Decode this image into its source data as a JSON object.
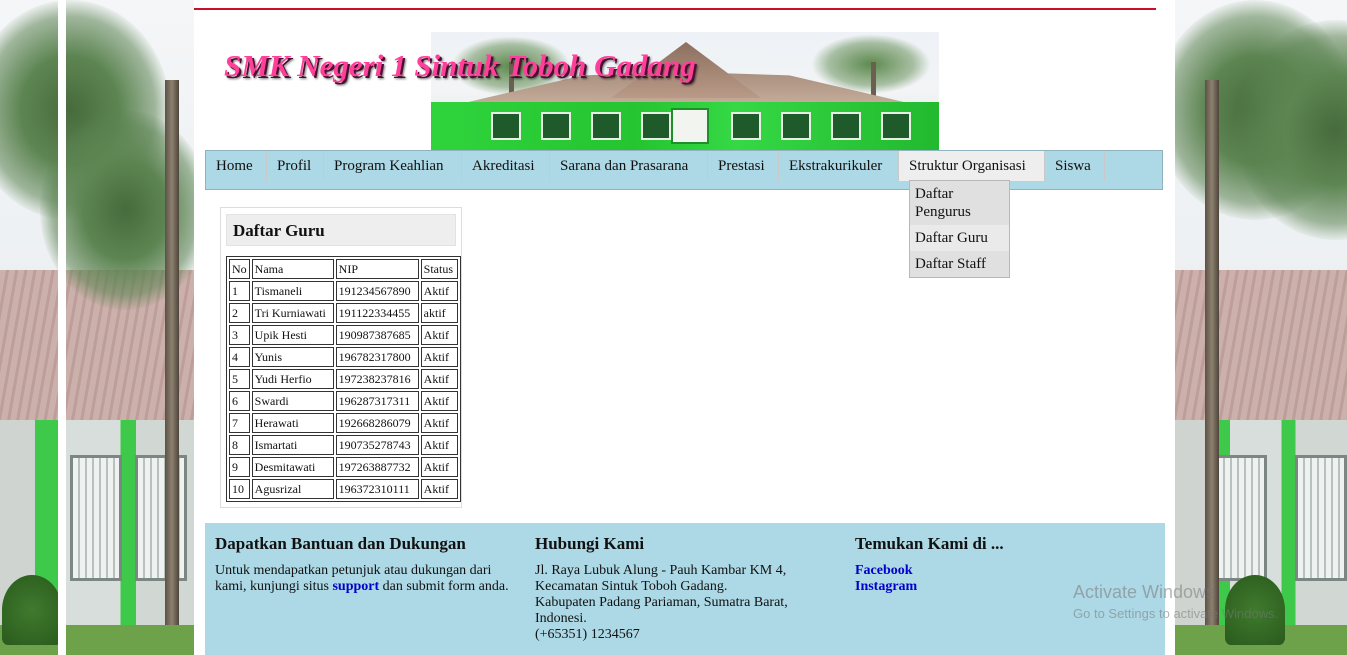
{
  "site": {
    "title": "SMK Negeri 1 Sintuk Toboh Gadang"
  },
  "nav": {
    "items": [
      {
        "label": "Home"
      },
      {
        "label": "Profil"
      },
      {
        "label": "Program Keahlian"
      },
      {
        "label": "Akreditasi"
      },
      {
        "label": "Sarana dan Prasarana"
      },
      {
        "label": "Prestasi"
      },
      {
        "label": "Ekstrakurikuler"
      },
      {
        "label": "Struktur Organisasi"
      },
      {
        "label": "Siswa"
      }
    ],
    "active_index": 7,
    "dropdown": [
      {
        "label": "Daftar Pengurus"
      },
      {
        "label": "Daftar Guru"
      },
      {
        "label": "Daftar Staff"
      }
    ]
  },
  "content": {
    "title": "Daftar Guru",
    "table": {
      "headers": [
        "No",
        "Nama",
        "NIP",
        "Status"
      ],
      "rows": [
        [
          "1",
          "Tismaneli",
          "191234567890",
          "Aktif"
        ],
        [
          "2",
          "Tri Kurniawati",
          "191122334455",
          "aktif"
        ],
        [
          "3",
          "Upik Hesti",
          "190987387685",
          "Aktif"
        ],
        [
          "4",
          "Yunis",
          "196782317800",
          "Aktif"
        ],
        [
          "5",
          "Yudi Herfio",
          "197238237816",
          "Aktif"
        ],
        [
          "6",
          "Swardi",
          "196287317311",
          "Aktif"
        ],
        [
          "7",
          "Herawati",
          "192668286079",
          "Aktif"
        ],
        [
          "8",
          "Ismartati",
          "190735278743",
          "Aktif"
        ],
        [
          "9",
          "Desmitawati",
          "197263887732",
          "Aktif"
        ],
        [
          "10",
          "Agusrizal",
          "196372310111",
          "Aktif"
        ]
      ]
    }
  },
  "footer": {
    "help": {
      "title": "Dapatkan Bantuan dan Dukungan",
      "text_before": "Untuk mendapatkan petunjuk atau dukungan dari kami, kunjungi situs ",
      "link": "support",
      "text_after": " dan submit form anda."
    },
    "contact": {
      "title": "Hubungi Kami",
      "lines": [
        "Jl. Raya Lubuk Alung - Pauh Kambar KM 4,",
        "Kecamatan Sintuk Toboh Gadang.",
        "Kabupaten Padang Pariaman, Sumatra Barat,",
        "Indonesi.",
        "(+65351) 1234567"
      ]
    },
    "social": {
      "title": "Temukan Kami di ...",
      "links": [
        "Facebook",
        "Instagram"
      ]
    }
  },
  "watermark": {
    "line1": "Activate Windows",
    "line2": "Go to Settings to activate Windows."
  },
  "colors": {
    "nav_bg": "#add8e6",
    "footer_bg": "#add8e6",
    "title_pink": "#ff3f9a",
    "top_line": "#c8102e",
    "link": "#0000cc"
  }
}
